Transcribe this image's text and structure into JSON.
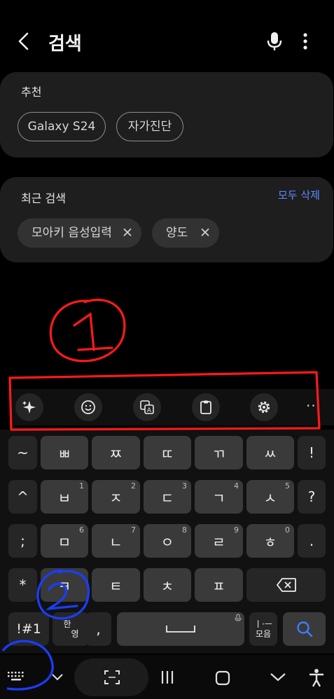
{
  "header": {
    "title": "검색"
  },
  "recommend": {
    "title": "추천",
    "chips": [
      "Galaxy S24",
      "자가진단"
    ]
  },
  "recent": {
    "title": "최근 검색",
    "delete_all": "모두 삭제",
    "chips": [
      "모아키 음성입력",
      "양도"
    ]
  },
  "keyboard": {
    "row1": [
      "~",
      "ㅃ",
      "ㅉ",
      "ㄸ",
      "ㄲ",
      "ㅆ",
      "!"
    ],
    "row2": [
      "^",
      "ㅂ",
      "ㅈ",
      "ㄷ",
      "ㄱ",
      "ㅅ",
      "?"
    ],
    "row2_nums": [
      "1",
      "2",
      "3",
      "4",
      "5"
    ],
    "row3": [
      ";",
      "ㅁ",
      "ㄴ",
      "ㅇ",
      "ㄹ",
      "ㅎ",
      "."
    ],
    "row3_nums": [
      "6",
      "7",
      "8",
      "9",
      "0"
    ],
    "row4": [
      "*",
      "ㅋ",
      "ㅌ",
      "ㅊ",
      "ㅍ"
    ],
    "sym_key": "!#1",
    "lang_key_top": "한",
    "lang_key_bottom": "영",
    "comma_key": ",",
    "vowel_key_top": "ㅣ·ㅡ",
    "vowel_key_bottom": "모음"
  },
  "annotations": {
    "marker1": "1",
    "marker2": "2"
  },
  "colors": {
    "accent": "#5b8dff",
    "annotation_red": "#ff1a1a",
    "annotation_blue": "#1a3dff"
  }
}
